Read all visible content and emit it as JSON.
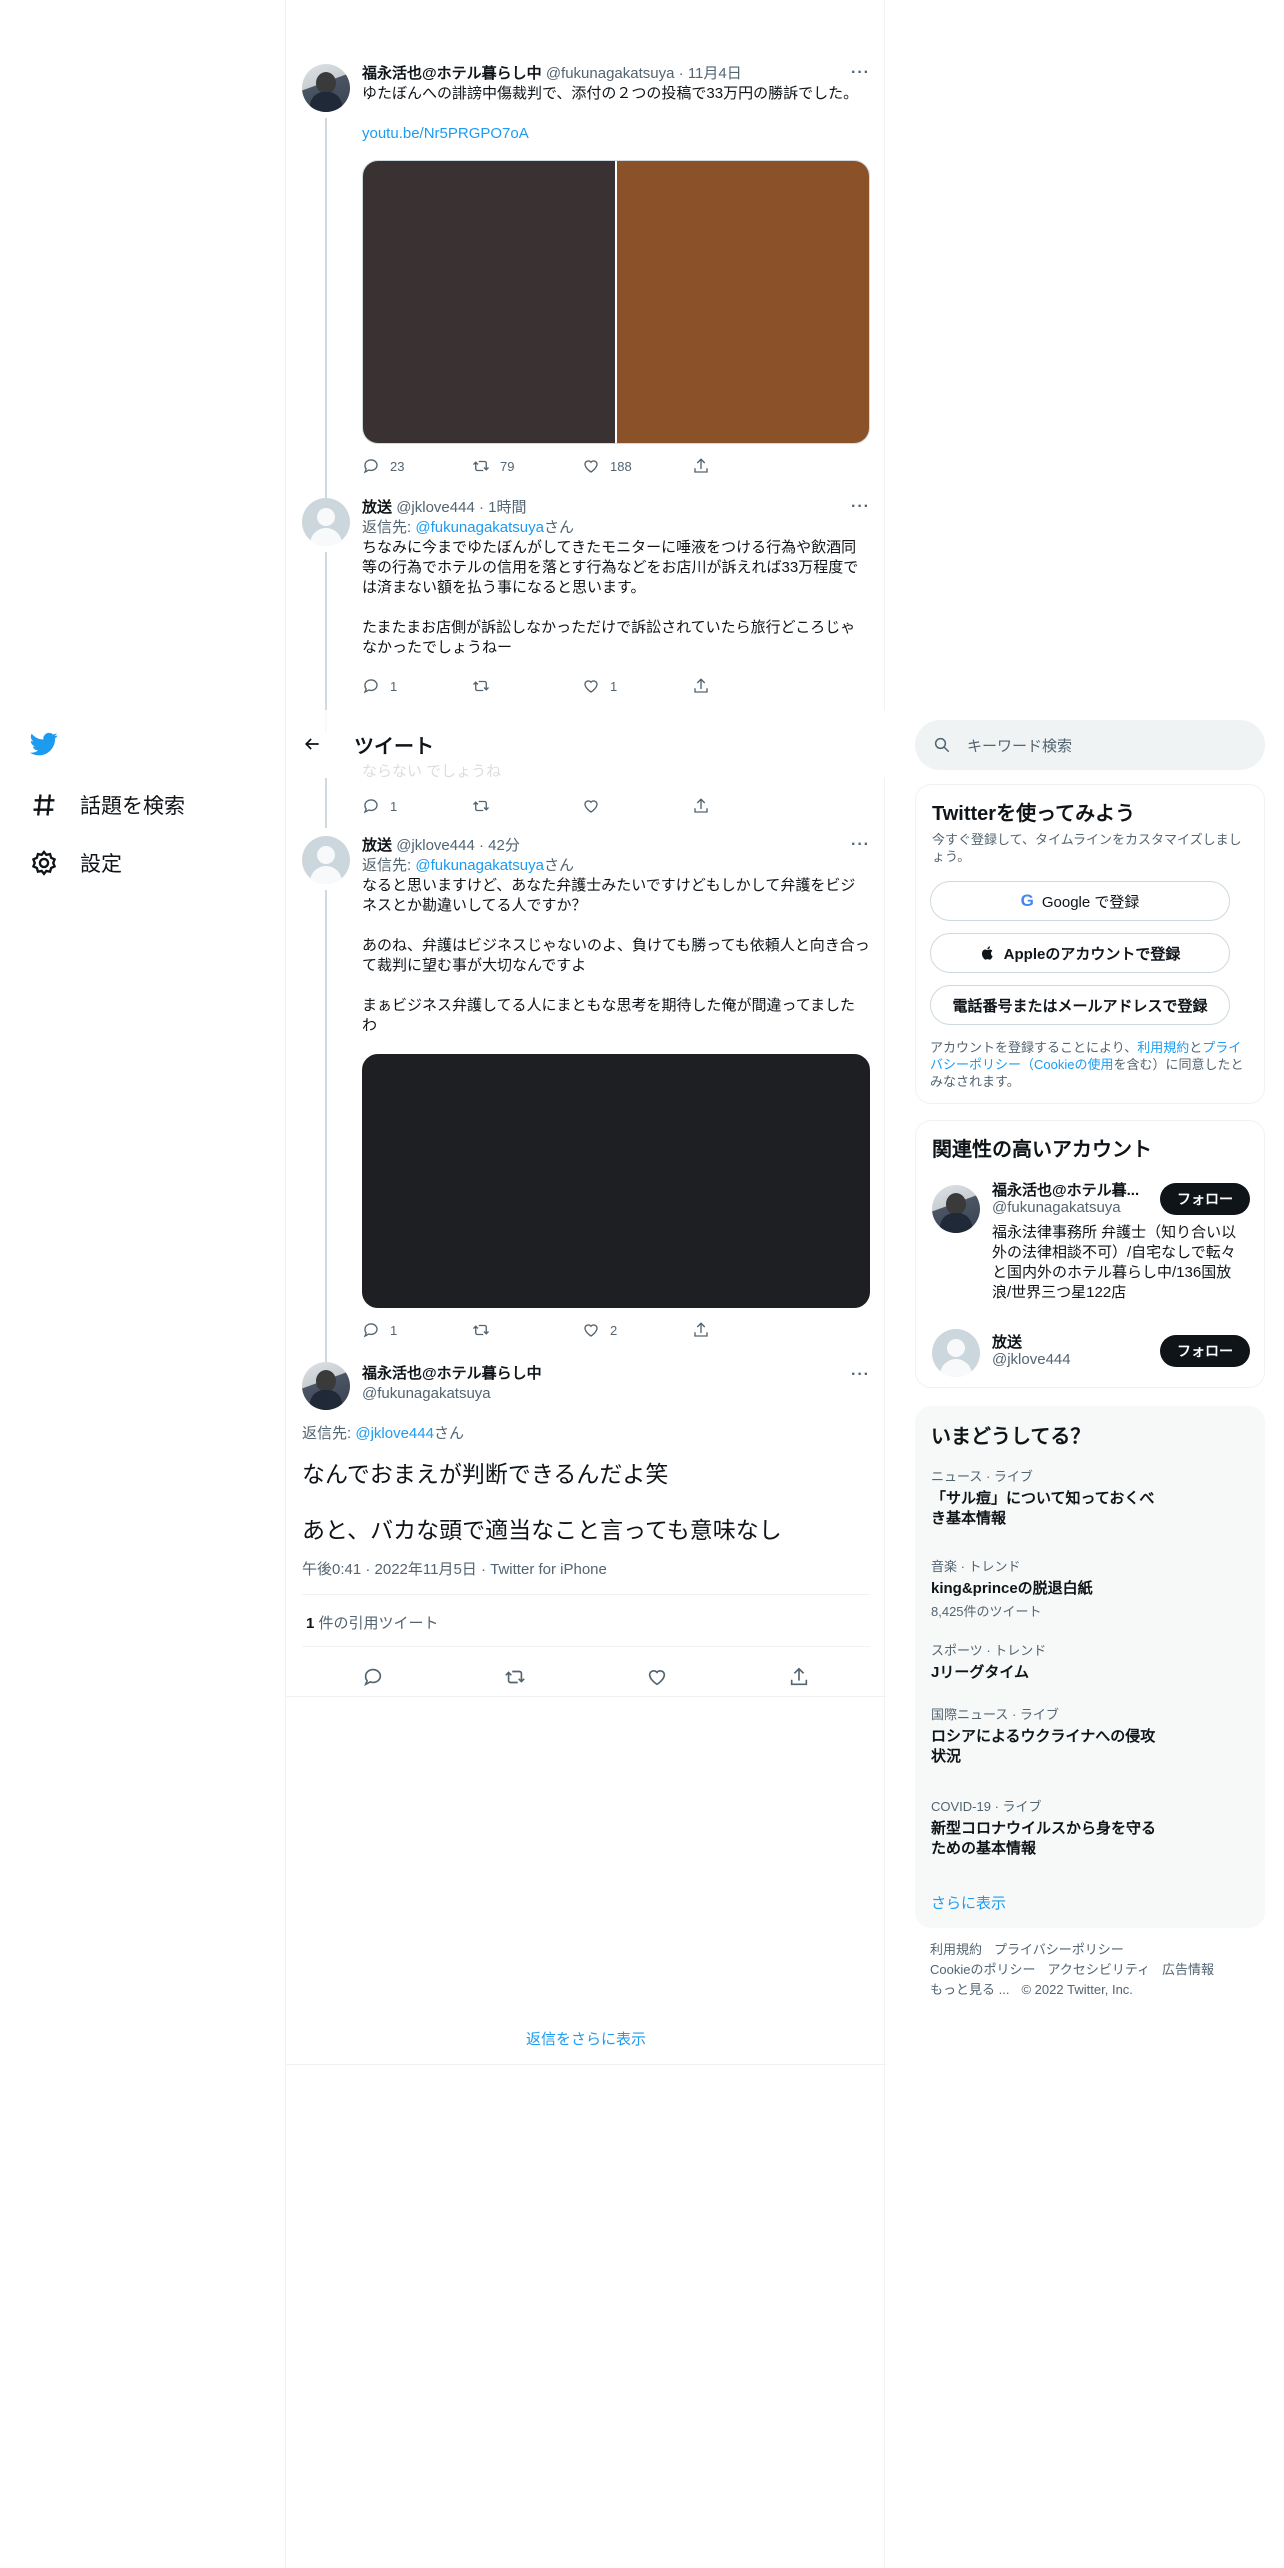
{
  "nav": {
    "explore_label": "話題を検索",
    "settings_label": "設定"
  },
  "header": {
    "title": "ツイート"
  },
  "tweets": {
    "t1": {
      "name": "福永活也@ホテル暮らし中",
      "handle": "@fukunagakatsuya",
      "time": "11月4日",
      "text": "ゆたぼんへの誹謗中傷裁判で、添付の２つの投稿で33万円の勝訴でした。",
      "link": "youtu.be/Nr5PRGPO7oA",
      "replies": "23",
      "retweets": "79",
      "likes": "188"
    },
    "t2": {
      "name": "放送",
      "handle": "@jklove444",
      "time": "1時間",
      "replying_prefix": "返信先: ",
      "replying_to": "@fukunagakatsuya",
      "replying_suffix": "さん",
      "text": "ちなみに今までゆたぼんがしてきたモニターに唾液をつける行為や飲酒同等の行為でホテルの信用を落とす行為などをお店川が訴えれば33万程度では済まない額を払う事になると思います。\n\nたまたまお店側が訴訟しなかっただけで訴訟されていたら旅行どころじゃなかったでしょうねー",
      "replies": "1",
      "retweets": "",
      "likes": "1"
    },
    "t3": {
      "partial_text": "ならない でしょうね",
      "replies": "1"
    },
    "t4": {
      "name": "放送",
      "handle": "@jklove444",
      "time": "42分",
      "replying_prefix": "返信先: ",
      "replying_to": "@fukunagakatsuya",
      "replying_suffix": "さん",
      "text": "なると思いますけど、あなた弁護士みたいですけどもしかして弁護をビジネスとか勘違いしてる人ですか？\n\nあのね、弁護はビジネスじゃないのよ、負けても勝っても依頼人と向き合って裁判に望む事が大切なんですよ\n\nまぁビジネス弁護してる人にまともな思考を期待した俺が間違ってましたわ",
      "replies": "1",
      "likes": "2"
    },
    "main": {
      "name": "福永活也@ホテル暮らし中",
      "handle": "@fukunagakatsuya",
      "replying_prefix": "返信先: ",
      "replying_to": "@jklove444",
      "replying_suffix": "さん",
      "line1": "なんでおまえが判断できるんだよ笑",
      "line2": "あと、バカな頭で適当なこと言っても意味なし",
      "meta": "午後0:41 · 2022年11月5日 · Twitter for iPhone",
      "quote_count": "1",
      "quote_label": "件の引用ツイート"
    }
  },
  "show_more_replies": "返信をさらに表示",
  "search": {
    "placeholder": "キーワード検索"
  },
  "signup": {
    "title": "Twitterを使ってみよう",
    "subtitle": "今すぐ登録して、タイムラインをカスタマイズしましょう。",
    "google": "Google で登録",
    "apple": "Appleのアカウントで登録",
    "phone": "電話番号またはメールアドレスで登録",
    "legal_pre": "アカウントを登録することにより、",
    "legal_terms": "利用規約",
    "legal_and": "と",
    "legal_privacy": "プライバシーポリシー（Cookieの使用",
    "legal_post": "を含む）に同意したとみなされます。"
  },
  "related": {
    "title": "関連性の高いアカウント",
    "accounts": [
      {
        "name": "福永活也@ホテル暮...",
        "handle": "@fukunagakatsuya",
        "bio": "福永法律事務所 弁護士（知り合い以外の法律相談不可）/自宅なしで転々と国内外のホテル暮らし中/136国放浪/世界三つ星122店",
        "follow": "フォロー"
      },
      {
        "name": "放送",
        "handle": "@jklove444",
        "follow": "フォロー"
      }
    ]
  },
  "trends": {
    "title": "いまどうしてる？",
    "items": [
      {
        "meta": "ニュース · ライブ",
        "name": "「サル痘」について知っておくべき基本情報",
        "count": ""
      },
      {
        "meta": "音楽 · トレンド",
        "name": "king&princeの脱退白紙",
        "count": "8,425件のツイート"
      },
      {
        "meta": "スポーツ · トレンド",
        "name": "Jリーグタイム",
        "count": ""
      },
      {
        "meta": "国際ニュース · ライブ",
        "name": "ロシアによるウクライナへの侵攻状況",
        "count": ""
      },
      {
        "meta": "COVID-19 · ライブ",
        "name": "新型コロナウイルスから身を守るための基本情報",
        "count": ""
      }
    ],
    "show_more": "さらに表示"
  },
  "footer": {
    "terms": "利用規約",
    "privacy": "プライバシーポリシー",
    "cookie": "Cookieのポリシー",
    "accessibility": "アクセシビリティ",
    "ads": "広告情報",
    "more": "もっと見る ...",
    "copyright": "© 2022 Twitter, Inc."
  },
  "colors": {
    "accent": "#1d9bf0",
    "text": "#0f1419",
    "secondary": "#536471"
  }
}
